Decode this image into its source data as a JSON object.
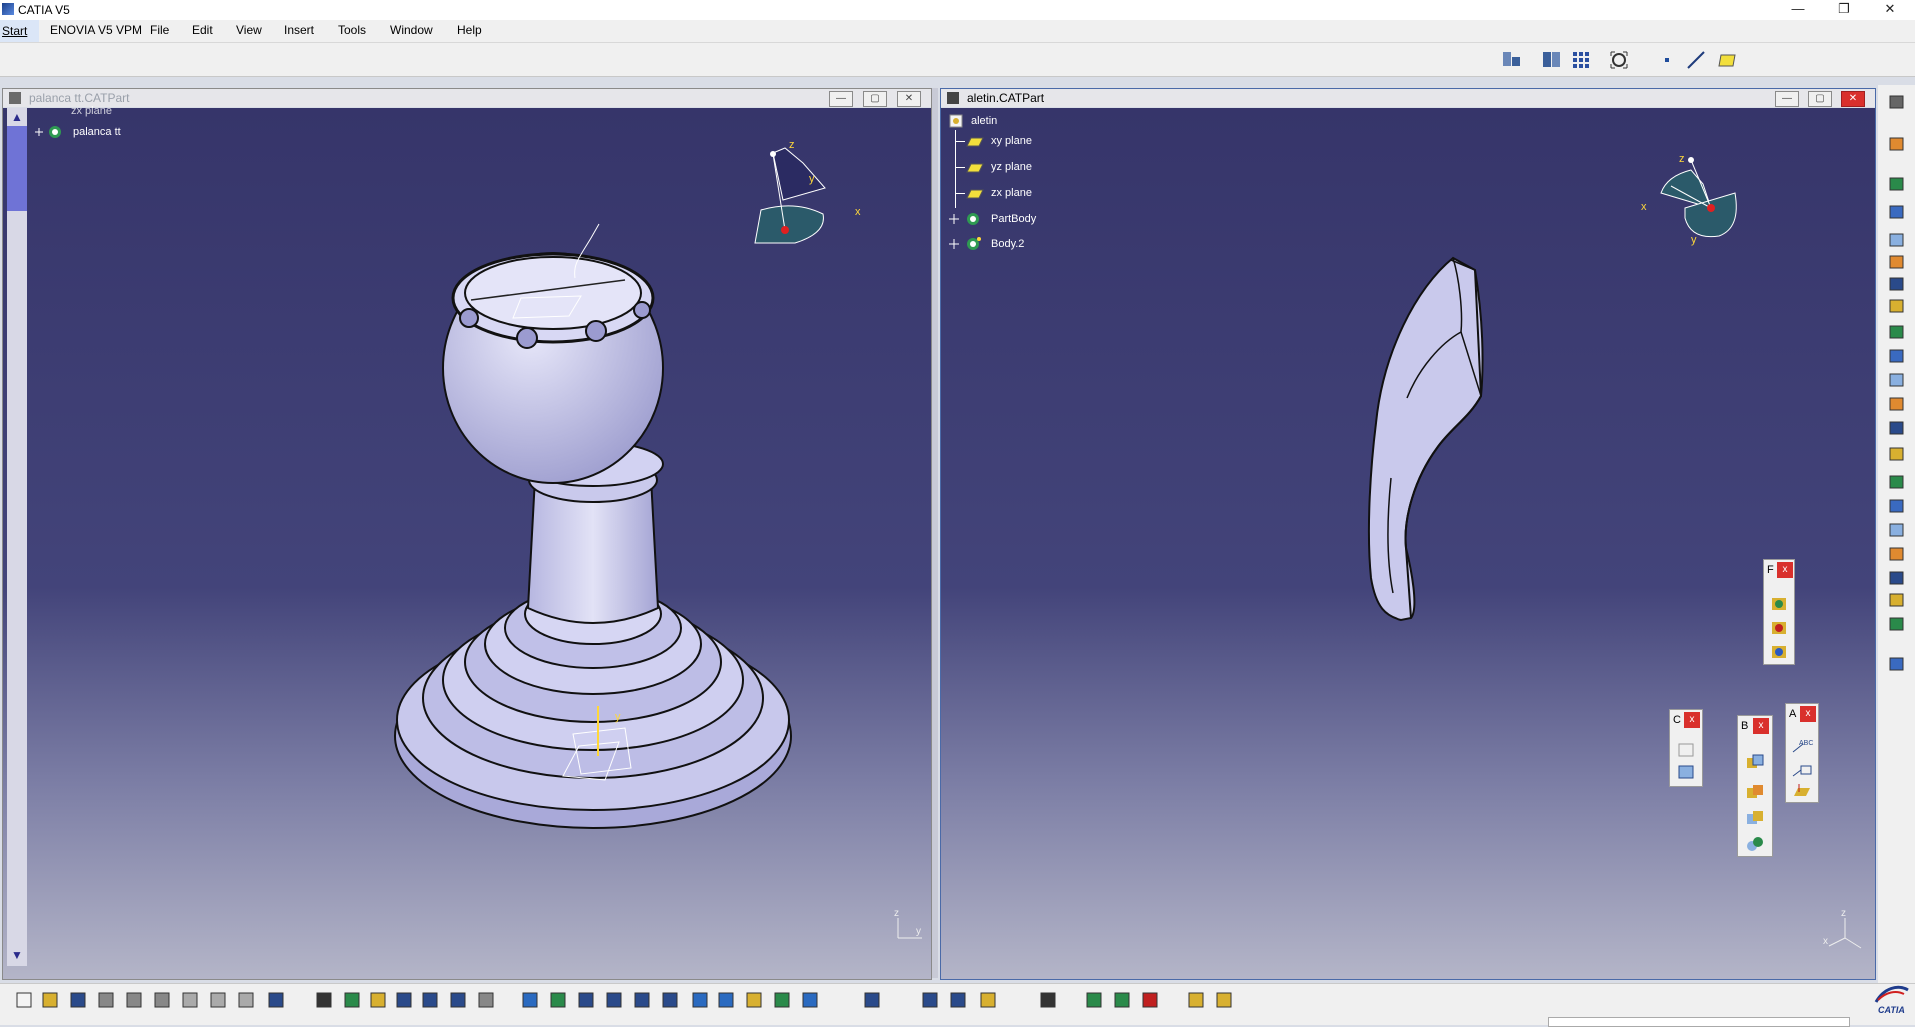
{
  "window": {
    "title": "CATIA V5",
    "controls": [
      "minimize",
      "restore",
      "close"
    ]
  },
  "menu": {
    "items": [
      "Start",
      "ENOVIA V5 VPM",
      "File",
      "Edit",
      "View",
      "Insert",
      "Tools",
      "Window",
      "Help"
    ]
  },
  "left_doc": {
    "title": "palanca tt.CATPart",
    "tree": {
      "partial_item": "zx plane",
      "root": "palanca tt"
    },
    "compass": {
      "x": "x",
      "y": "y",
      "z": "z"
    },
    "axis": {
      "y": "y",
      "z": "z"
    },
    "state": "inactive"
  },
  "right_doc": {
    "title": "aletin.CATPart",
    "tree": {
      "root": "aletin",
      "items": [
        "xy plane",
        "yz plane",
        "zx plane",
        "PartBody",
        "Body.2"
      ]
    },
    "compass": {
      "x": "x",
      "y": "y",
      "z": "z"
    },
    "axis": {
      "x": "x",
      "z": "z"
    },
    "state": "active"
  },
  "floating_toolbars": [
    {
      "letter": "F",
      "close": "x"
    },
    {
      "letter": "C",
      "close": "x"
    },
    {
      "letter": "B",
      "close": "x"
    },
    {
      "letter": "A",
      "close": "x"
    }
  ],
  "brand": {
    "logo_text": "CATIA"
  },
  "colors": {
    "background_top": "#36356a",
    "background_bottom": "#b4b5c8",
    "part_fill": "#c9c9ec",
    "tree_text": "#ffffff",
    "close_red": "#d9302c"
  },
  "right_toolbar_icons": [
    "settings-icon",
    "select-arrow-icon",
    "sketcher-icon",
    "pad-icon",
    "pocket-icon",
    "shaft-icon",
    "groove-icon",
    "hole-icon",
    "rib-icon",
    "slot-icon",
    "stiffener-icon",
    "multi-section-solid-icon",
    "removed-multi-section-icon",
    "fillet-icon",
    "chamfer-icon",
    "draft-icon",
    "shell-icon",
    "thickness-icon",
    "thread-icon",
    "remove-face-icon",
    "replace-face-icon",
    "boolean-operations-icon"
  ],
  "bottom_toolbar_icons": [
    "new-icon",
    "open-icon",
    "save-icon",
    "print-icon",
    "cut-icon",
    "copy-icon",
    "paste-icon",
    "undo-icon",
    "redo-icon",
    "whats-this-icon",
    "formula-icon",
    "knowledge-advisor-icon",
    "measure-icon",
    "table-icon",
    "graph-tree-icon",
    "catalog-icon",
    "apply-material-icon",
    "fly-mode-icon",
    "fit-all-icon",
    "pan-icon",
    "rotate-icon",
    "zoom-in-icon",
    "zoom-out-icon",
    "normal-view-icon",
    "iso-view-icon",
    "render-style-icon",
    "hide-show-icon",
    "swap-space-icon",
    "update-icon",
    "axis-system-icon",
    "measure-between-icon",
    "measure-item-icon",
    "capture-icon",
    "sketch-analysis-icon",
    "draft-analysis-icon",
    "curvature-analysis-icon",
    "ref-element-icon",
    "plane-icon"
  ]
}
